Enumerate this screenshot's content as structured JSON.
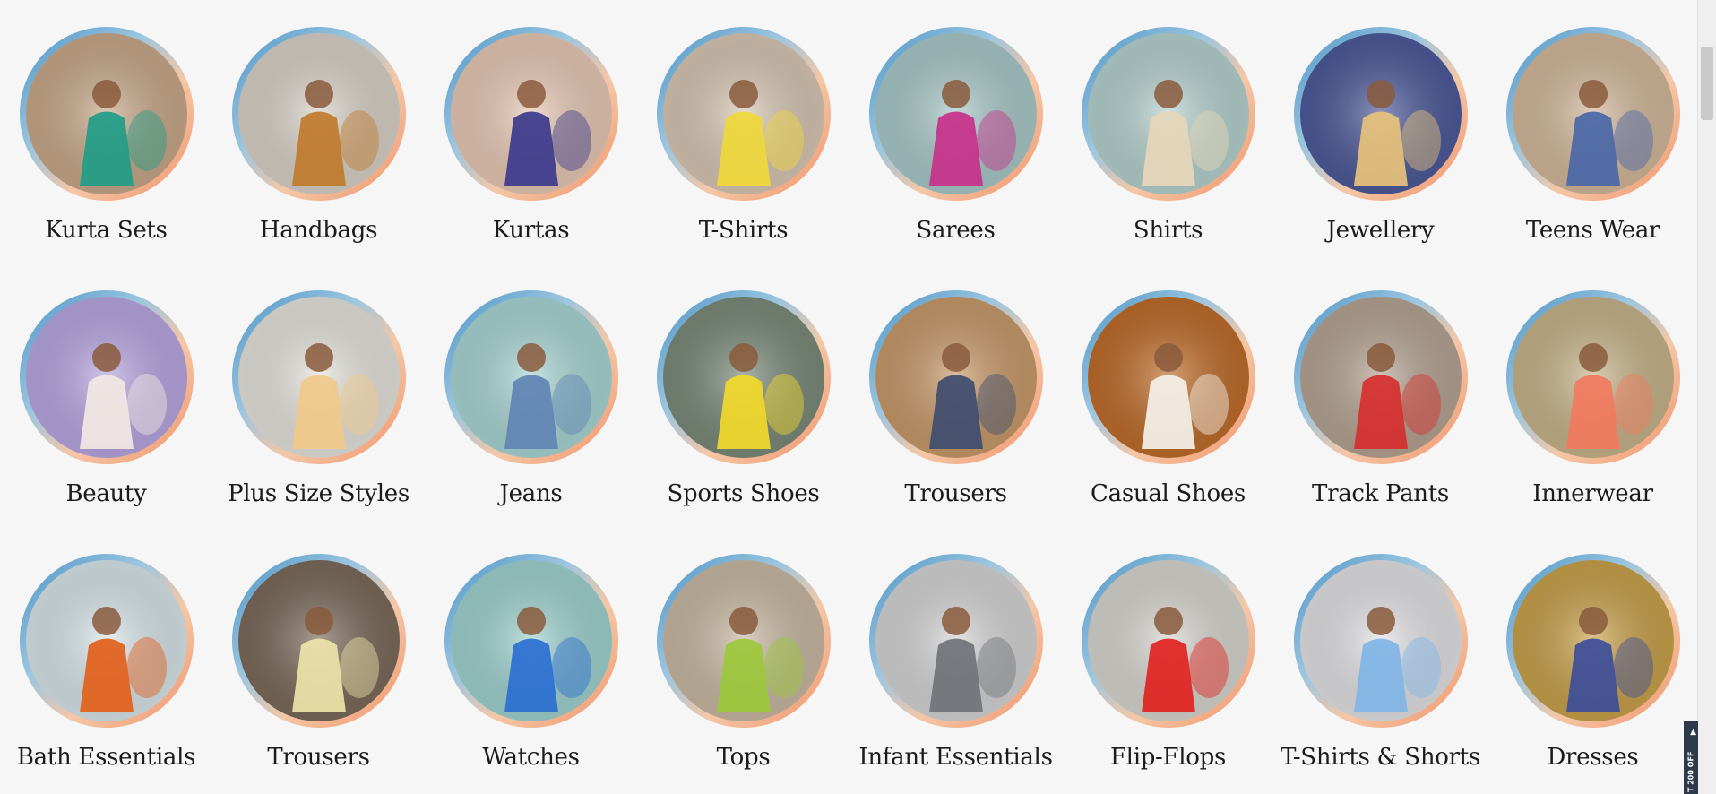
{
  "categories": [
    {
      "label": "Kurta Sets",
      "icon": "kurta-sets-image",
      "bg": "#c9a98a",
      "fg": "#1f9c86"
    },
    {
      "label": "Handbags",
      "icon": "handbag-image",
      "bg": "#d9d2c8",
      "fg": "#c07a2c"
    },
    {
      "label": "Kurtas",
      "icon": "kurtas-image",
      "bg": "#e9c9b5",
      "fg": "#3c3a8c"
    },
    {
      "label": "T-Shirts",
      "icon": "tshirts-image",
      "bg": "#d8c7b4",
      "fg": "#f0d83a"
    },
    {
      "label": "Sarees",
      "icon": "sarees-image",
      "bg": "#a9c9c9",
      "fg": "#c8308a"
    },
    {
      "label": "Shirts",
      "icon": "shirts-image",
      "bg": "#b6d2cf",
      "fg": "#e6d6b8"
    },
    {
      "label": "Jewellery",
      "icon": "jewellery-image",
      "bg": "#4d5a9a",
      "fg": "#e7c27a"
    },
    {
      "label": "Teens Wear",
      "icon": "teens-wear-image",
      "bg": "#d3b89a",
      "fg": "#4a67a8"
    },
    {
      "label": "Beauty",
      "icon": "beauty-image",
      "bg": "#b8a6e2",
      "fg": "#f1e8e3"
    },
    {
      "label": "Plus Size Styles",
      "icon": "plus-size-image",
      "bg": "#e7e4dd",
      "fg": "#f0c98a"
    },
    {
      "label": "Jeans",
      "icon": "jeans-image",
      "bg": "#a9d6d4",
      "fg": "#5f84b3"
    },
    {
      "label": "Sports Shoes",
      "icon": "sports-shoes-image",
      "bg": "#7b8a7a",
      "fg": "#f2d92a"
    },
    {
      "label": "Trousers",
      "icon": "trousers-image",
      "bg": "#c99a6a",
      "fg": "#3f4d70"
    },
    {
      "label": "Casual Shoes",
      "icon": "casual-shoes-image",
      "bg": "#c06d2a",
      "fg": "#f4f1ea"
    },
    {
      "label": "Track Pants",
      "icon": "track-pants-image",
      "bg": "#b6a493",
      "fg": "#d62e2e"
    },
    {
      "label": "Innerwear",
      "icon": "innerwear-image",
      "bg": "#c8b48a",
      "fg": "#f27a5e"
    },
    {
      "label": "Bath Essentials",
      "icon": "bath-essentials-image",
      "bg": "#d9e6ea",
      "fg": "#e25e1a"
    },
    {
      "label": "Trousers",
      "icon": "trousers-women-image",
      "bg": "#7b6a5a",
      "fg": "#eee3a8"
    },
    {
      "label": "Watches",
      "icon": "watches-image",
      "bg": "#9fd3d0",
      "fg": "#2a6fd1"
    },
    {
      "label": "Tops",
      "icon": "tops-image",
      "bg": "#c9b9a3",
      "fg": "#9cc83a"
    },
    {
      "label": "Infant Essentials",
      "icon": "infant-essentials-image",
      "bg": "#d5d5d5",
      "fg": "#6f7378"
    },
    {
      "label": "Flip-Flops",
      "icon": "flip-flops-image",
      "bg": "#d8d6d0",
      "fg": "#e2231f"
    },
    {
      "label": "T-Shirts & Shorts",
      "icon": "tshirts-shorts-image",
      "bg": "#e3e3e6",
      "fg": "#7fb4e6"
    },
    {
      "label": "Dresses",
      "icon": "dresses-image",
      "bg": "#c9a24a",
      "fg": "#3d4e9a"
    }
  ],
  "promo": {
    "text": "T 200 OFF"
  }
}
